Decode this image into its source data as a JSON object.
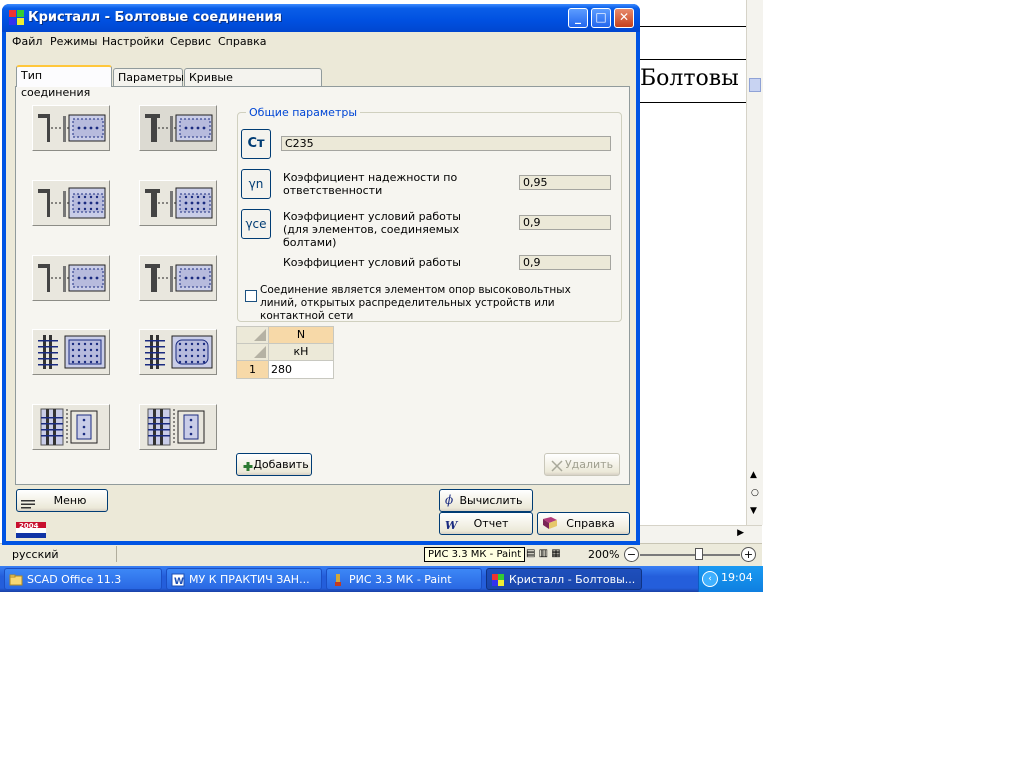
{
  "window": {
    "title": "Кристалл - Болтовые соединения",
    "minimize": "_",
    "maximize": "□",
    "close": "✕"
  },
  "menu": [
    "Файл",
    "Режимы",
    "Настройки",
    "Сервис",
    "Справка"
  ],
  "tabs": [
    {
      "label": "Тип соединения",
      "active": true
    },
    {
      "label": "Параметры",
      "active": false
    },
    {
      "label": "Кривые взаимодействия",
      "active": false
    }
  ],
  "schemes": {
    "count": 10,
    "selected_index": 1
  },
  "general_params": {
    "legend": "Общие параметры",
    "steel_button": "Ст",
    "steel_value": "С235",
    "gamma_n_button": "γn",
    "gamma_n_label": "Коэффициент надежности по ответственности",
    "gamma_n_value": "0,95",
    "gamma_ce_button": "γce",
    "gamma_ce_label": "Коэффициент условий работы (для элементов, соединяемых болтами)",
    "gamma_ce_value": "0,9",
    "gamma_c_label": "Коэффициент условий работы",
    "gamma_c_value": "0,9",
    "checkbox_label": "Соединение является элементом опор высоковольтных линий, открытых распределительных устройств или контактной сети",
    "checkbox_checked": false
  },
  "load_table": {
    "header": "N",
    "unit": "кН",
    "rows": [
      {
        "index": "1",
        "value": "280"
      }
    ]
  },
  "buttons": {
    "add": "Добавить",
    "delete": "Удалить",
    "menu": "Меню",
    "calculate": "Вычислить",
    "report": "Отчет",
    "help": "Справка"
  },
  "logo_text": "2004",
  "background": {
    "doc_word": "Болтовы",
    "language": "русский",
    "zoom": "200%",
    "tooltip": "РИС 3.3 МК - Paint"
  },
  "taskbar": {
    "items": [
      {
        "label": "SCAD Office 11.3",
        "active": false
      },
      {
        "label": "МУ К ПРАКТИЧ ЗАН...",
        "active": false
      },
      {
        "label": "РИС 3.3 МК - Paint",
        "active": false
      },
      {
        "label": "Кристалл - Болтовы...",
        "active": true
      }
    ],
    "clock": "19:04"
  }
}
